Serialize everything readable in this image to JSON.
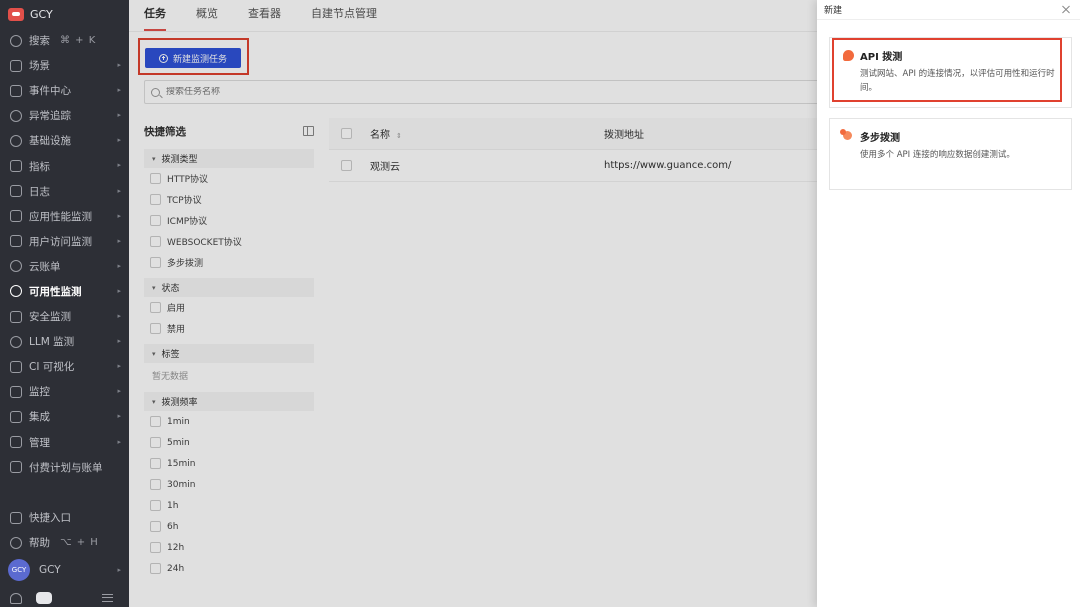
{
  "brand": {
    "name": "GCY"
  },
  "sidebar": {
    "search": {
      "label": "搜索",
      "shortcut": "⌘ + K"
    },
    "items": [
      {
        "label": "场景",
        "icon": "monitor-icon"
      },
      {
        "label": "事件中心",
        "icon": "event-icon"
      },
      {
        "label": "异常追踪",
        "icon": "target-icon"
      },
      {
        "label": "基础设施",
        "icon": "nodes-icon"
      },
      {
        "label": "指标",
        "icon": "chart-icon"
      },
      {
        "label": "日志",
        "icon": "log-icon"
      },
      {
        "label": "应用性能监测",
        "icon": "apm-icon"
      },
      {
        "label": "用户访问监测",
        "icon": "grid-icon"
      },
      {
        "label": "云账单",
        "icon": "cloud-icon"
      },
      {
        "label": "可用性监测",
        "icon": "dial-icon",
        "active": true
      },
      {
        "label": "安全监测",
        "icon": "shield-icon"
      },
      {
        "label": "LLM 监测",
        "icon": "llm-icon"
      },
      {
        "label": "CI 可视化",
        "icon": "ci-icon"
      },
      {
        "label": "监控",
        "icon": "alarm-icon"
      },
      {
        "label": "集成",
        "icon": "cube-icon"
      },
      {
        "label": "管理",
        "icon": "sliders-icon"
      },
      {
        "label": "付费计划与账单",
        "icon": "bill-icon"
      }
    ],
    "quick_entry": "快捷入口",
    "help": {
      "label": "帮助",
      "shortcut": "⌥ + H"
    },
    "user": {
      "avatar": "GCY",
      "name": "GCY"
    }
  },
  "tabs": [
    "任务",
    "概览",
    "查看器",
    "自建节点管理"
  ],
  "toolbar": {
    "new_task_label": "新建监测任务"
  },
  "search": {
    "placeholder": "搜索任务名称"
  },
  "filter": {
    "title": "快捷筛选",
    "groups": [
      {
        "label": "拨测类型",
        "options": [
          "HTTP协议",
          "TCP协议",
          "ICMP协议",
          "WEBSOCKET协议",
          "多步拨测"
        ]
      },
      {
        "label": "状态",
        "options": [
          "启用",
          "禁用"
        ]
      },
      {
        "label": "标签",
        "empty": "暂无数据"
      },
      {
        "label": "拨测频率",
        "options": [
          "1min",
          "5min",
          "15min",
          "30min",
          "1h",
          "6h",
          "12h",
          "24h"
        ]
      }
    ]
  },
  "table": {
    "columns": [
      "名称",
      "拨测地址"
    ],
    "rows": [
      {
        "name": "观测云",
        "url": "https://www.guance.com/"
      }
    ]
  },
  "drawer": {
    "title": "新建",
    "cards": [
      {
        "title": "API 拨测",
        "desc": "测试网站、API 的连接情况，以评估可用性和运行时间。"
      },
      {
        "title": "多步拨测",
        "desc": "使用多个 API 连接的响应数据创建测试。"
      }
    ]
  },
  "colors": {
    "accent": "#e2504a",
    "primary_button": "#2f53d9",
    "highlight_border": "#e0412f",
    "sidebar_bg": "#2d2f36"
  }
}
